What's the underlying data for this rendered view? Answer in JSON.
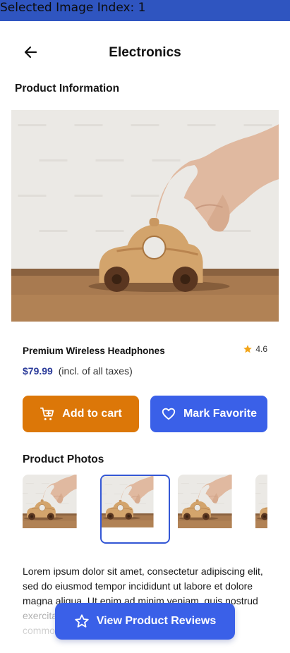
{
  "debug": {
    "text": "Selected Image Index: 1"
  },
  "header": {
    "title": "Electronics"
  },
  "sections": {
    "product_info": "Product Information",
    "product_photos": "Product Photos"
  },
  "product": {
    "name": "Premium Wireless Headphones",
    "rating": "4.6",
    "price": "$79.99",
    "price_note": "(incl. of all taxes)",
    "selected_image_index": 1
  },
  "actions": {
    "add_to_cart": "Add to cart",
    "mark_favorite": "Mark Favorite",
    "view_reviews": "View Product Reviews"
  },
  "description": "Lorem ipsum dolor sit amet, consectetur adipiscing elit, sed do eiusmod tempor incididunt ut labore et dolore magna aliqua. Ut enim ad minim veniam, quis nostrud exercitation ullamco laboris nisi ut aliquip ex ea commodo consequat. Duis aute irure dolor in",
  "colors": {
    "debug_bar": "#2f55c0",
    "price": "#2d3d9b",
    "cart_button": "#dc7708",
    "primary": "#3a60e8",
    "star": "#f2a51a"
  },
  "icons": {
    "back": "arrow-left-icon",
    "star": "star-icon",
    "cart": "cart-plus-icon",
    "heart": "heart-icon",
    "reviews": "star-outline-icon"
  }
}
